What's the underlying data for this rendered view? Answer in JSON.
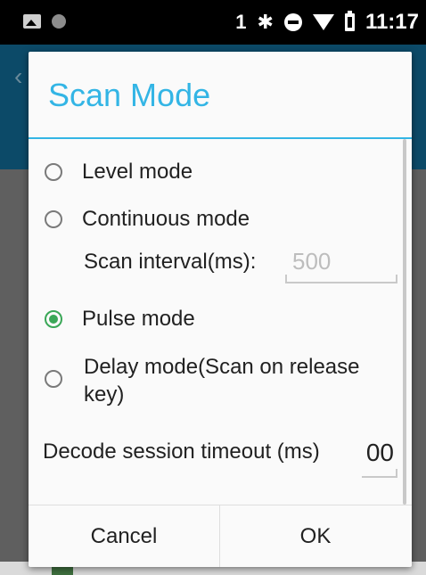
{
  "status_bar": {
    "sim_label": "1",
    "time": "11:17",
    "icons": [
      "image-icon",
      "dot-icon",
      "bluetooth-icon",
      "do-not-disturb-icon",
      "wifi-icon",
      "battery-icon"
    ]
  },
  "dialog": {
    "title": "Scan Mode",
    "accent_color": "#33b5e5",
    "options": [
      {
        "label": "Level mode",
        "checked": false
      },
      {
        "label": "Continuous mode",
        "checked": false
      },
      {
        "label": "Pulse mode",
        "checked": true
      },
      {
        "label": "Delay mode(Scan on release key)",
        "checked": false
      }
    ],
    "scan_interval": {
      "label": "Scan interval(ms):",
      "placeholder": "500"
    },
    "decode_timeout": {
      "label": "Decode session timeout (ms)",
      "value": "00"
    },
    "buttons": {
      "cancel": "Cancel",
      "ok": "OK"
    }
  }
}
